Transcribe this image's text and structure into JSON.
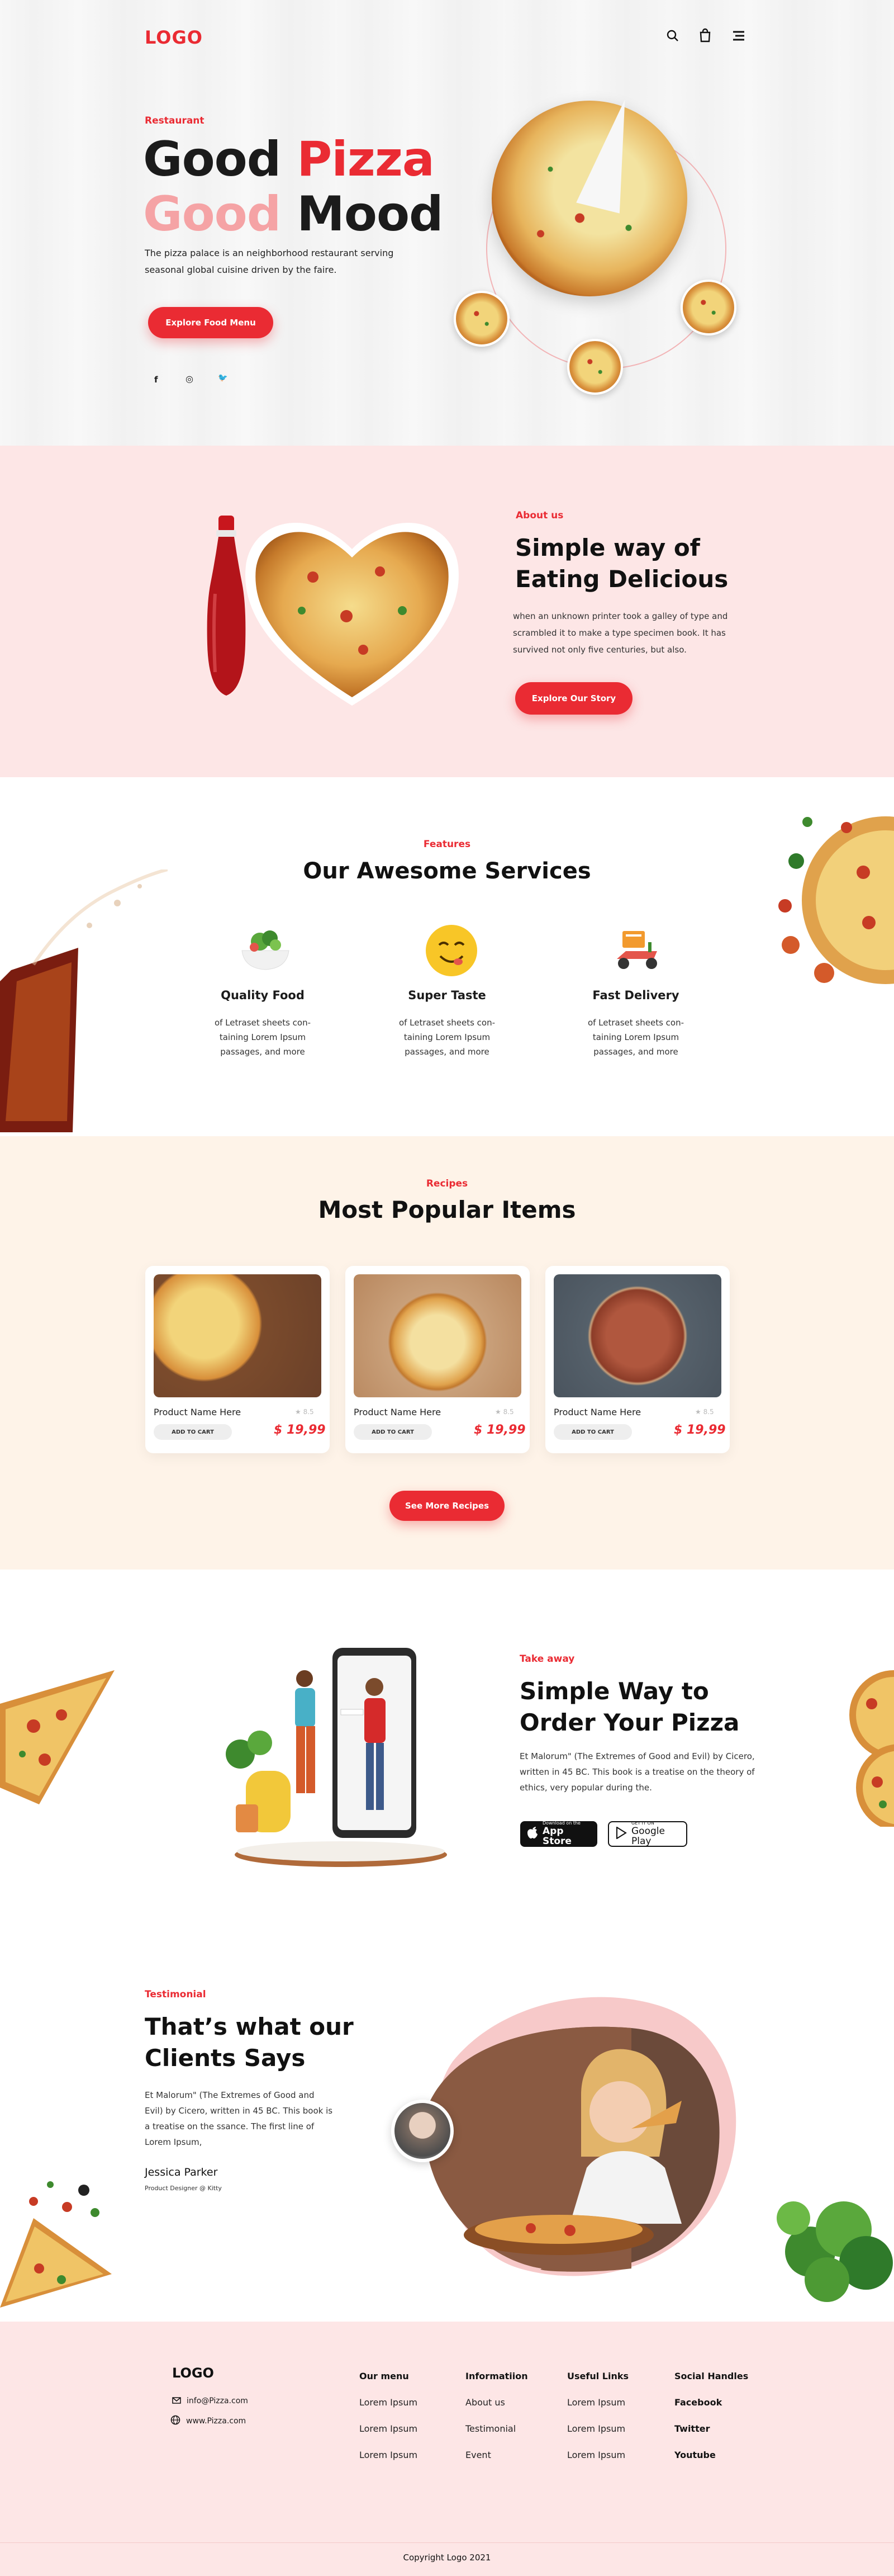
{
  "header": {
    "logo": "LOGO",
    "icons": [
      "search-icon",
      "cart-icon",
      "menu-icon"
    ]
  },
  "hero": {
    "eyebrow": "Restaurant",
    "title_line1_a": "Good",
    "title_line1_b": "Pizza",
    "title_line2_a": "Good",
    "title_line2_b": "Mood",
    "description": "The pizza palace is an neighborhood restaurant serving seasonal global cuisine driven by the faire.",
    "cta": "Explore Food Menu",
    "social": [
      "facebook-icon",
      "instagram-icon",
      "twitter-icon"
    ],
    "social_glyphs": [
      "f",
      "◎",
      "🐦"
    ]
  },
  "about": {
    "eyebrow": "About us",
    "title": "Simple way of Eating Delicious",
    "description": "when an unknown printer took a galley of type and scrambled it to make a type specimen book. It has survived not only five centuries, but also.",
    "cta": "Explore Our Story"
  },
  "services": {
    "eyebrow": "Features",
    "title": "Our Awesome Services",
    "items": [
      {
        "title": "Quality Food",
        "description": "of Letraset sheets con-taining Lorem Ipsum passages, and more",
        "icon": "salad-bowl-icon"
      },
      {
        "title": "Super Taste",
        "description": "of Letraset sheets con-taining Lorem Ipsum passages, and more",
        "icon": "yum-face-icon"
      },
      {
        "title": "Fast Delivery",
        "description": "of Letraset sheets con-taining Lorem Ipsum passages, and more",
        "icon": "delivery-scooter-icon"
      }
    ]
  },
  "recipes": {
    "eyebrow": "Recipes",
    "title": "Most Popular Items",
    "cards": [
      {
        "name": "Product Name Here",
        "rating": "★ 8.5",
        "cart": "ADD TO CART",
        "price": "$ 19,99"
      },
      {
        "name": "Product Name Here",
        "rating": "★ 8.5",
        "cart": "ADD TO CART",
        "price": "$ 19,99"
      },
      {
        "name": "Product Name Here",
        "rating": "★ 8.5",
        "cart": "ADD TO CART",
        "price": "$ 19,99"
      }
    ],
    "cta": "See More Recipes"
  },
  "takeaway": {
    "eyebrow": "Take away",
    "title": "Simple Way to Order Your Pizza",
    "description": "Et Malorum\" (The Extremes of Good and Evil) by Cicero, written in 45 BC. This book is a treatise on the theory of ethics, very popular during the.",
    "app_store_small": "Download on the",
    "app_store": "App Store",
    "google_play_small": "GET IT ON",
    "google_play": "Google Play"
  },
  "testimonial": {
    "eyebrow": "Testimonial",
    "title": "That’s what our Clients Says",
    "quote": "Et Malorum\" (The Extremes of Good and Evil) by Cicero, written in 45 BC. This book is a treatise on the ssance. The first line of Lorem Ipsum,",
    "name": "Jessica Parker",
    "role": "Product Designer @ Kitty"
  },
  "footer": {
    "logo": "LOGO",
    "email": "info@Pizza.com",
    "website": "www.Pizza.com",
    "columns": [
      {
        "heading": "Our menu",
        "links": [
          "Lorem Ipsum",
          "Lorem Ipsum",
          "Lorem Ipsum"
        ]
      },
      {
        "heading": "Informatiion",
        "links": [
          "About us",
          "Testimonial",
          "Event"
        ]
      },
      {
        "heading": "Useful Links",
        "links": [
          "Lorem Ipsum",
          "Lorem Ipsum",
          "Lorem Ipsum"
        ]
      },
      {
        "heading": "Social Handles",
        "links": [
          "Facebook",
          "Twitter",
          "Youtube"
        ]
      }
    ],
    "copyright": "Copyright Logo 2021"
  },
  "colors": {
    "accent": "#ea2b33",
    "pink_light": "#fde6e6",
    "cream": "#fef3e8",
    "title_pink": "#f5a3a5"
  }
}
